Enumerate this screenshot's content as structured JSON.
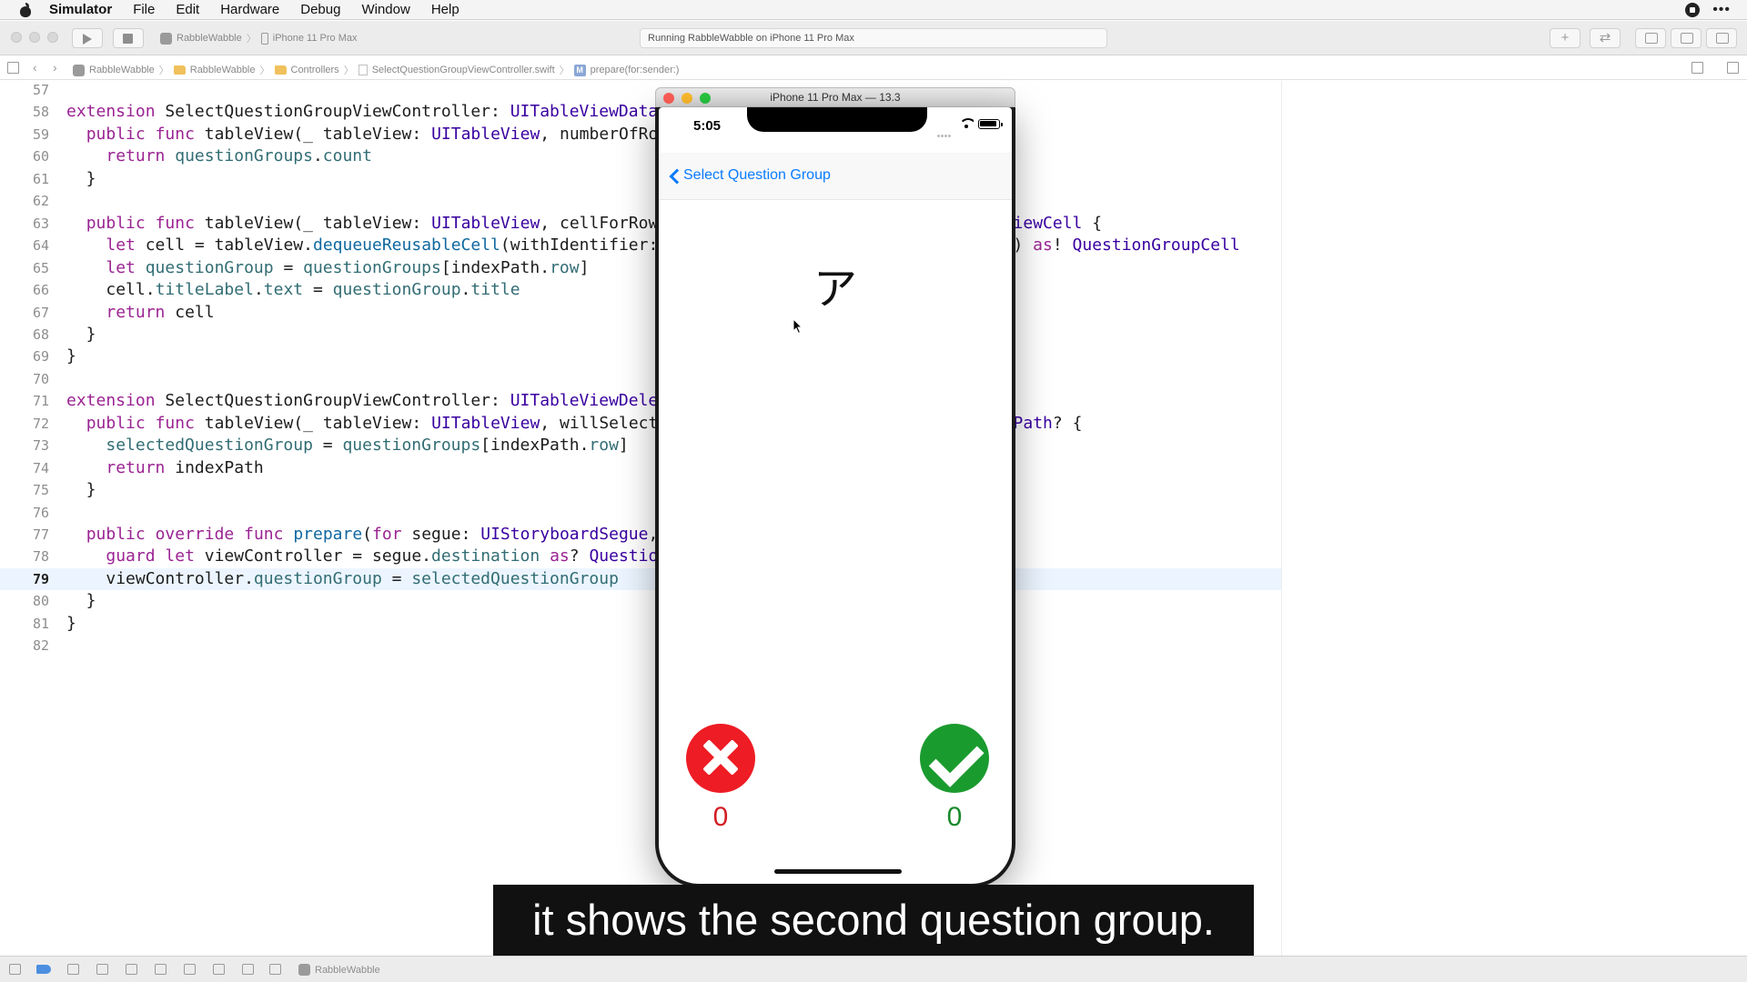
{
  "menubar": {
    "app_name": "Simulator",
    "items": [
      "File",
      "Edit",
      "Hardware",
      "Debug",
      "Window",
      "Help"
    ]
  },
  "toolbar": {
    "scheme": "RabbleWabble",
    "device": "iPhone 11 Pro Max",
    "activity": "Running RabbleWabble on iPhone 11 Pro Max",
    "add_label": "+",
    "swap_label": "⇄"
  },
  "jumpbar": {
    "crumbs": [
      "RabbleWabble",
      "RabbleWabble",
      "Controllers",
      "SelectQuestionGroupViewController.swift",
      "prepare(for:sender:)"
    ],
    "method_badge": "M"
  },
  "code": {
    "lines": [
      {
        "n": "57",
        "t": ""
      },
      {
        "n": "58",
        "t": "extension SelectQuestionGroupViewController: UITableViewDataSource {"
      },
      {
        "n": "59",
        "t": "  public func tableView(_ tableView: UITableView, numberOfRowsInSection section: Int) -> Int {"
      },
      {
        "n": "60",
        "t": "    return questionGroups.count"
      },
      {
        "n": "61",
        "t": "  }"
      },
      {
        "n": "62",
        "t": ""
      },
      {
        "n": "63",
        "t": "  public func tableView(_ tableView: UITableView, cellForRowAt indexPath: IndexPath) -> UITableViewCell {"
      },
      {
        "n": "64",
        "t": "    let cell = tableView.dequeueReusableCell(withIdentifier: \"QuestionGroupCell\", for: indexPath) as! QuestionGroupCell"
      },
      {
        "n": "65",
        "t": "    let questionGroup = questionGroups[indexPath.row]"
      },
      {
        "n": "66",
        "t": "    cell.titleLabel.text = questionGroup.title"
      },
      {
        "n": "67",
        "t": "    return cell"
      },
      {
        "n": "68",
        "t": "  }"
      },
      {
        "n": "69",
        "t": "}"
      },
      {
        "n": "70",
        "t": ""
      },
      {
        "n": "71",
        "t": "extension SelectQuestionGroupViewController: UITableViewDelegate {"
      },
      {
        "n": "72",
        "t": "  public func tableView(_ tableView: UITableView, willSelectRowAt indexPath: IndexPath) -> IndexPath? {"
      },
      {
        "n": "73",
        "t": "    selectedQuestionGroup = questionGroups[indexPath.row]"
      },
      {
        "n": "74",
        "t": "    return indexPath"
      },
      {
        "n": "75",
        "t": "  }"
      },
      {
        "n": "76",
        "t": ""
      },
      {
        "n": "77",
        "t": "  public override func prepare(for segue: UIStoryboardSegue, sender: Any?) {"
      },
      {
        "n": "78",
        "t": "    guard let viewController = segue.destination as? QuestionViewController else { return }"
      },
      {
        "n": "79",
        "t": "    viewController.questionGroup = selectedQuestionGroup"
      },
      {
        "n": "80",
        "t": "  }"
      },
      {
        "n": "81",
        "t": "}"
      },
      {
        "n": "82",
        "t": ""
      }
    ],
    "current_line": "79"
  },
  "simulator": {
    "window_title": "iPhone 11 Pro Max — 13.3",
    "status_time": "5:05",
    "back_label": "Select Question Group",
    "prompt": "ア",
    "wrong_count": "0",
    "correct_count": "0"
  },
  "subtitle": "it shows the second question group.",
  "debugbar": {
    "target": "RabbleWabble"
  },
  "colors": {
    "keyword": "#9b2393",
    "type": "#3900a0",
    "wrong": "#ee1c24",
    "correct": "#1a9b2e",
    "tint": "#0a7bff"
  }
}
